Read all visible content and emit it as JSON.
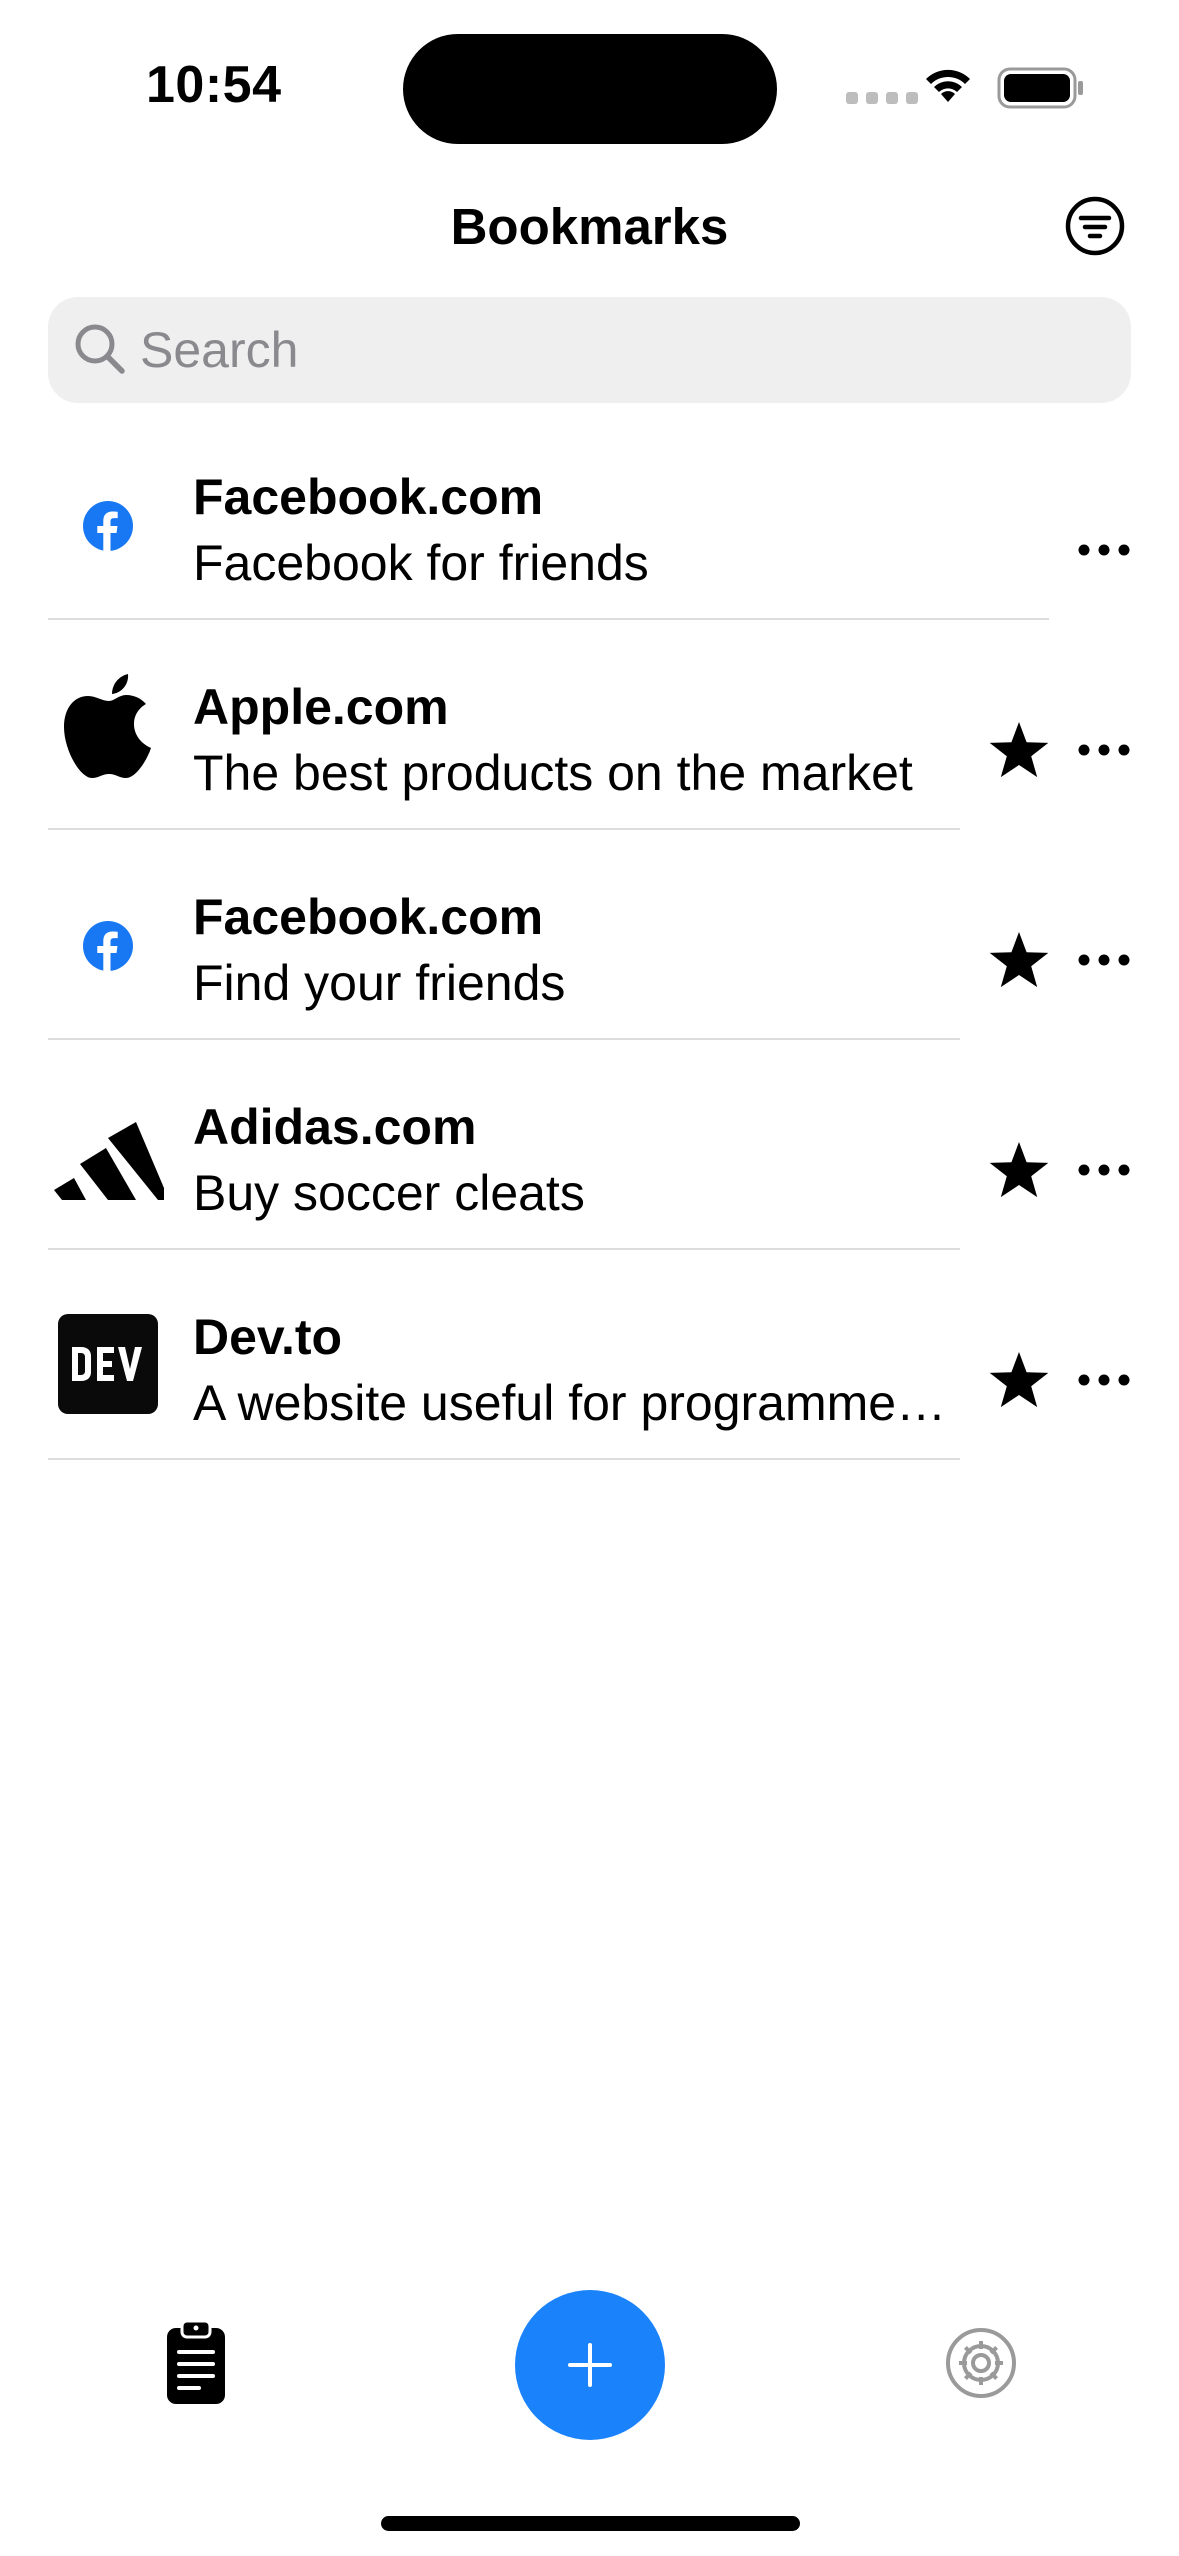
{
  "status_bar": {
    "time": "10:54"
  },
  "nav": {
    "title": "Bookmarks"
  },
  "search": {
    "placeholder": "Search",
    "value": ""
  },
  "bookmarks": [
    {
      "title": "Facebook.com",
      "subtitle": "Facebook for friends",
      "icon": "facebook-icon",
      "favorite": false
    },
    {
      "title": "Apple.com",
      "subtitle": "The best products on the market",
      "icon": "apple-icon",
      "favorite": true
    },
    {
      "title": "Facebook.com",
      "subtitle": "Find your friends",
      "icon": "facebook-icon",
      "favorite": true
    },
    {
      "title": "Adidas.com",
      "subtitle": "Buy soccer cleats",
      "icon": "adidas-icon",
      "favorite": true
    },
    {
      "title": "Dev.to",
      "subtitle": "A website useful for programme…",
      "icon": "dev-icon",
      "favorite": true
    }
  ],
  "tab_bar": {
    "left": "clipboard-list-icon",
    "center": "plus-icon",
    "right": "gear-icon"
  },
  "colors": {
    "accent": "#1a82fb",
    "facebook": "#1877f2",
    "search_bg": "#efeff0",
    "divider": "#dcdcdc",
    "inactive": "#9a9a9a"
  }
}
